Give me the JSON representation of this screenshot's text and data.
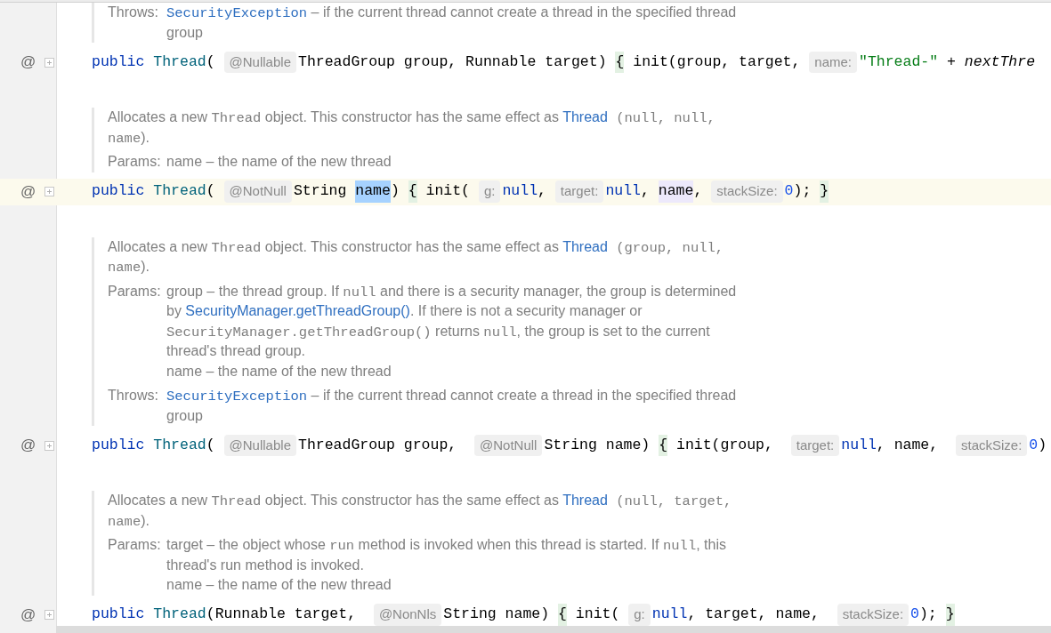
{
  "blocks": [
    {
      "kind": "doc",
      "sections": [
        {
          "label": "Throws:",
          "lines": [
            [
              {
                "kind": "codelink",
                "t": "SecurityException"
              },
              {
                "kind": "text",
                "t": " – if the current thread cannot create a thread in the specified thread"
              }
            ],
            [
              {
                "kind": "text",
                "t": "group"
              }
            ]
          ]
        }
      ]
    },
    {
      "kind": "code",
      "gutter": "@",
      "highlighted": false,
      "tokens": [
        {
          "kind": "modifier",
          "t": "public"
        },
        {
          "kind": "type",
          "t": "Thread"
        },
        {
          "kind": "plain",
          "t": "( "
        },
        {
          "kind": "hint",
          "t": "@Nullable"
        },
        {
          "kind": "plain",
          "t": "ThreadGroup group, Runnable target) "
        },
        {
          "kind": "brace",
          "t": "{"
        },
        {
          "kind": "plain",
          "t": " init(group, target, "
        },
        {
          "kind": "hint",
          "t": "name:"
        },
        {
          "kind": "string",
          "t": "\"Thread-\""
        },
        {
          "kind": "plain",
          "t": " + "
        },
        {
          "kind": "italic",
          "t": "nextThre"
        }
      ]
    },
    {
      "kind": "doc",
      "description": [
        [
          {
            "kind": "text",
            "t": "Allocates a new "
          },
          {
            "kind": "code",
            "t": "Thread"
          },
          {
            "kind": "text",
            "t": " object. This constructor has the same effect as "
          },
          {
            "kind": "link",
            "t": "Thread"
          },
          {
            "kind": "code",
            "t": " (null, null,"
          }
        ],
        [
          {
            "kind": "code",
            "t": "name"
          },
          {
            "kind": "text",
            "t": ")."
          }
        ]
      ],
      "sections": [
        {
          "label": "Params:",
          "lines": [
            [
              {
                "kind": "text",
                "t": "name – the name of the new thread"
              }
            ]
          ]
        }
      ]
    },
    {
      "kind": "code",
      "gutter": "@",
      "highlighted": true,
      "tokens": [
        {
          "kind": "modifier",
          "t": "public"
        },
        {
          "kind": "type",
          "t": "Thread"
        },
        {
          "kind": "plain",
          "t": "( "
        },
        {
          "kind": "hint",
          "t": "@NotNull"
        },
        {
          "kind": "plain",
          "t": "String "
        },
        {
          "kind": "selected",
          "t": "name"
        },
        {
          "kind": "plain",
          "t": ") "
        },
        {
          "kind": "brace",
          "t": "{"
        },
        {
          "kind": "plain",
          "t": " init( "
        },
        {
          "kind": "hint",
          "t": "g:"
        },
        {
          "kind": "keyword",
          "t": "null"
        },
        {
          "kind": "plain",
          "t": ", "
        },
        {
          "kind": "hint",
          "t": "target:"
        },
        {
          "kind": "keyword",
          "t": "null"
        },
        {
          "kind": "plain",
          "t": ", "
        },
        {
          "kind": "usage",
          "t": "name"
        },
        {
          "kind": "plain",
          "t": ", "
        },
        {
          "kind": "hint",
          "t": "stackSize:"
        },
        {
          "kind": "number",
          "t": "0"
        },
        {
          "kind": "plain",
          "t": "); "
        },
        {
          "kind": "brace",
          "t": "}"
        }
      ]
    },
    {
      "kind": "doc",
      "description": [
        [
          {
            "kind": "text",
            "t": "Allocates a new "
          },
          {
            "kind": "code",
            "t": "Thread"
          },
          {
            "kind": "text",
            "t": " object. This constructor has the same effect as "
          },
          {
            "kind": "link",
            "t": "Thread"
          },
          {
            "kind": "code",
            "t": " (group, null,"
          }
        ],
        [
          {
            "kind": "code",
            "t": "name"
          },
          {
            "kind": "text",
            "t": ")."
          }
        ]
      ],
      "sections": [
        {
          "label": "Params:",
          "lines": [
            [
              {
                "kind": "text",
                "t": "group – the thread group. If "
              },
              {
                "kind": "code",
                "t": "null"
              },
              {
                "kind": "text",
                "t": " and there is a security manager, the group is determined"
              }
            ],
            [
              {
                "kind": "text",
                "t": "by "
              },
              {
                "kind": "link",
                "t": "SecurityManager.getThreadGroup()"
              },
              {
                "kind": "text",
                "t": ". If there is not a security manager or"
              }
            ],
            [
              {
                "kind": "code",
                "t": "SecurityManager.getThreadGroup()"
              },
              {
                "kind": "text",
                "t": " returns "
              },
              {
                "kind": "code",
                "t": "null"
              },
              {
                "kind": "text",
                "t": ", the group is set to the current"
              }
            ],
            [
              {
                "kind": "text",
                "t": "thread's thread group."
              }
            ],
            [
              {
                "kind": "text",
                "t": "name – the name of the new thread"
              }
            ]
          ]
        },
        {
          "label": "Throws:",
          "lines": [
            [
              {
                "kind": "codelink",
                "t": "SecurityException"
              },
              {
                "kind": "text",
                "t": " – if the current thread cannot create a thread in the specified thread"
              }
            ],
            [
              {
                "kind": "text",
                "t": "group"
              }
            ]
          ]
        }
      ]
    },
    {
      "kind": "code",
      "gutter": "@",
      "highlighted": false,
      "tokens": [
        {
          "kind": "modifier",
          "t": "public"
        },
        {
          "kind": "type",
          "t": "Thread"
        },
        {
          "kind": "plain",
          "t": "( "
        },
        {
          "kind": "hint",
          "t": "@Nullable"
        },
        {
          "kind": "plain",
          "t": "ThreadGroup group,  "
        },
        {
          "kind": "hint",
          "t": "@NotNull"
        },
        {
          "kind": "plain",
          "t": "String name) "
        },
        {
          "kind": "brace",
          "t": "{"
        },
        {
          "kind": "plain",
          "t": " init(group,  "
        },
        {
          "kind": "hint",
          "t": "target:"
        },
        {
          "kind": "keyword",
          "t": "null"
        },
        {
          "kind": "plain",
          "t": ", name,  "
        },
        {
          "kind": "hint",
          "t": "stackSize:"
        },
        {
          "kind": "number",
          "t": "0"
        },
        {
          "kind": "plain",
          "t": ")"
        }
      ]
    },
    {
      "kind": "doc",
      "description": [
        [
          {
            "kind": "text",
            "t": "Allocates a new "
          },
          {
            "kind": "code",
            "t": "Thread"
          },
          {
            "kind": "text",
            "t": " object. This constructor has the same effect as "
          },
          {
            "kind": "link",
            "t": "Thread"
          },
          {
            "kind": "code",
            "t": " (null, target,"
          }
        ],
        [
          {
            "kind": "code",
            "t": "name"
          },
          {
            "kind": "text",
            "t": ")."
          }
        ]
      ],
      "sections": [
        {
          "label": "Params:",
          "lines": [
            [
              {
                "kind": "text",
                "t": "target – the object whose "
              },
              {
                "kind": "code",
                "t": "run"
              },
              {
                "kind": "text",
                "t": " method is invoked when this thread is started. If "
              },
              {
                "kind": "code",
                "t": "null"
              },
              {
                "kind": "text",
                "t": ", this"
              }
            ],
            [
              {
                "kind": "text",
                "t": "thread's run method is invoked."
              }
            ],
            [
              {
                "kind": "text",
                "t": "name – the name of the new thread"
              }
            ]
          ]
        }
      ]
    },
    {
      "kind": "code",
      "gutter": "@",
      "highlighted": false,
      "tokens": [
        {
          "kind": "modifier",
          "t": "public"
        },
        {
          "kind": "type",
          "t": "Thread"
        },
        {
          "kind": "plain",
          "t": "(Runnable target,  "
        },
        {
          "kind": "hint",
          "t": "@NonNls"
        },
        {
          "kind": "plain",
          "t": "String name) "
        },
        {
          "kind": "brace",
          "t": "{"
        },
        {
          "kind": "plain",
          "t": " init( "
        },
        {
          "kind": "hint",
          "t": "g:"
        },
        {
          "kind": "keyword",
          "t": "null"
        },
        {
          "kind": "plain",
          "t": ", target, name,  "
        },
        {
          "kind": "hint",
          "t": "stackSize:"
        },
        {
          "kind": "number",
          "t": "0"
        },
        {
          "kind": "plain",
          "t": "); "
        },
        {
          "kind": "brace",
          "t": "}"
        }
      ]
    }
  ]
}
